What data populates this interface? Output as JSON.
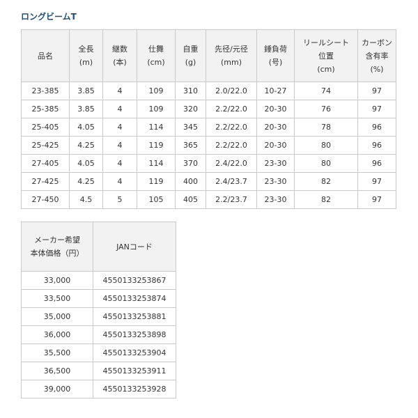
{
  "title": "ロングビームT",
  "spec_table": {
    "headers": [
      [
        "品名"
      ],
      [
        "全長",
        "(m)"
      ],
      [
        "継数",
        "(本)"
      ],
      [
        "仕舞",
        "(cm)"
      ],
      [
        "自重",
        "(g)"
      ],
      [
        "先径/元径",
        "(mm)"
      ],
      [
        "錘負荷",
        "(号)"
      ],
      [
        "リールシート",
        "位置",
        "(cm)"
      ],
      [
        "カーボン",
        "含有率",
        "(%)"
      ]
    ],
    "rows": [
      [
        "23-385",
        "3.85",
        "4",
        "109",
        "310",
        "2.0/22.0",
        "10-27",
        "74",
        "97"
      ],
      [
        "25-385",
        "3.85",
        "4",
        "109",
        "320",
        "2.2/22.0",
        "20-30",
        "76",
        "97"
      ],
      [
        "25-405",
        "4.05",
        "4",
        "114",
        "345",
        "2.2/22.0",
        "20-30",
        "78",
        "96"
      ],
      [
        "25-425",
        "4.25",
        "4",
        "119",
        "365",
        "2.2/22.0",
        "20-30",
        "80",
        "96"
      ],
      [
        "27-405",
        "4.05",
        "4",
        "114",
        "370",
        "2.4/22.0",
        "23-30",
        "80",
        "96"
      ],
      [
        "27-425",
        "4.25",
        "4",
        "119",
        "400",
        "2.4/23.7",
        "23-30",
        "82",
        "97"
      ],
      [
        "27-450",
        "4.5",
        "5",
        "105",
        "405",
        "2.2/23.7",
        "23-30",
        "82",
        "97"
      ]
    ]
  },
  "price_table": {
    "headers": [
      [
        "メーカー希望",
        "本体価格（円）"
      ],
      [
        "JANコード"
      ]
    ],
    "rows": [
      [
        "33,000",
        "4550133253867"
      ],
      [
        "33,500",
        "4550133253874"
      ],
      [
        "35,000",
        "4550133253881"
      ],
      [
        "36,000",
        "4550133253898"
      ],
      [
        "35,500",
        "4550133253904"
      ],
      [
        "36,500",
        "4550133253911"
      ],
      [
        "39,000",
        "4550133253928"
      ]
    ]
  },
  "colors": {
    "title": "#1f4e79",
    "header_bg": "#f2f2f2",
    "border": "#c9c9c9",
    "text": "#333333"
  }
}
